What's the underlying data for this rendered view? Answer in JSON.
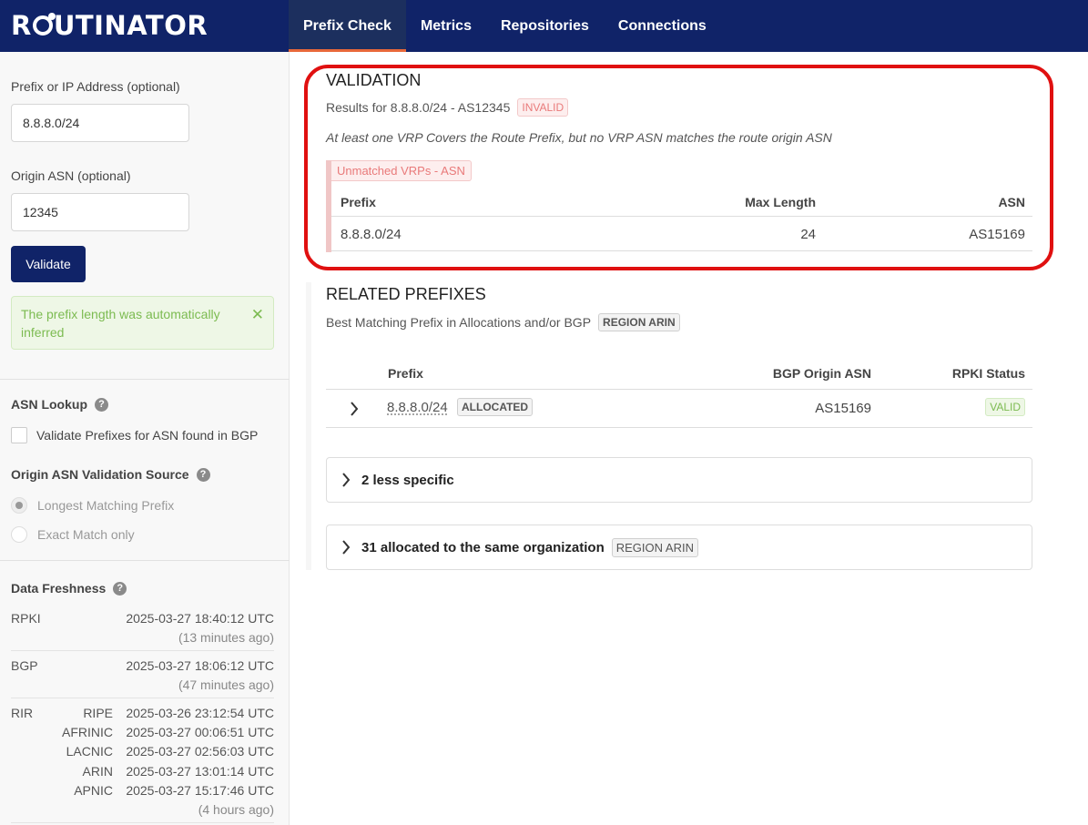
{
  "app": {
    "logo": "ROUTINATOR",
    "logo_parts": [
      "R",
      "UTINATOR"
    ]
  },
  "nav": {
    "tabs": [
      {
        "label": "Prefix Check",
        "active": true
      },
      {
        "label": "Metrics"
      },
      {
        "label": "Repositories"
      },
      {
        "label": "Connections"
      }
    ]
  },
  "form": {
    "prefix_label": "Prefix or IP Address (optional)",
    "prefix_value": "8.8.8.0/24",
    "asn_label": "Origin ASN (optional)",
    "asn_value": "12345",
    "validate_label": "Validate",
    "alert_text": "The prefix length was automatically inferred",
    "alert_close": "✕"
  },
  "asn_lookup": {
    "title": "ASN Lookup",
    "checkbox_label": "Validate Prefixes for ASN found in BGP",
    "checked": false
  },
  "origin_source": {
    "title": "Origin ASN Validation Source",
    "options": [
      {
        "label": "Longest Matching Prefix",
        "selected": true
      },
      {
        "label": "Exact Match only",
        "selected": false
      }
    ]
  },
  "freshness": {
    "title": "Data Freshness",
    "rpki": {
      "name": "RPKI",
      "time": "2025-03-27 18:40:12 UTC",
      "ago": "(13 minutes ago)"
    },
    "bgp": {
      "name": "BGP",
      "time": "2025-03-27 18:06:12 UTC",
      "ago": "(47 minutes ago)"
    },
    "rir": {
      "name": "RIR",
      "sources": [
        {
          "name": "RIPE",
          "time": "2025-03-26 23:12:54 UTC"
        },
        {
          "name": "AFRINIC",
          "time": "2025-03-27 00:06:51 UTC"
        },
        {
          "name": "LACNIC",
          "time": "2025-03-27 02:56:03 UTC"
        },
        {
          "name": "ARIN",
          "time": "2025-03-27 13:01:14 UTC"
        },
        {
          "name": "APNIC",
          "time": "2025-03-27 15:17:46 UTC"
        }
      ],
      "ago": "(4 hours ago)"
    },
    "help": "?"
  },
  "validation": {
    "title": "VALIDATION",
    "results_text": "Results for 8.8.8.0/24 - AS12345",
    "status": "INVALID",
    "note": "At least one VRP Covers the Route Prefix, but no VRP ASN matches the route origin ASN",
    "unmatched_tag": "Unmatched VRPs - ASN",
    "columns": {
      "prefix": "Prefix",
      "max_length": "Max Length",
      "asn": "ASN"
    },
    "rows": [
      {
        "prefix": "8.8.8.0/24",
        "max_length": "24",
        "asn": "AS15169"
      }
    ]
  },
  "related": {
    "title": "RELATED PREFIXES",
    "subtitle": "Best Matching Prefix in Allocations and/or BGP",
    "region_badge": "REGION ARIN",
    "columns": {
      "prefix": "Prefix",
      "bgp_origin": "BGP Origin ASN",
      "rpki_status": "RPKI Status"
    },
    "rows": [
      {
        "prefix": "8.8.8.0/24",
        "tag": "ALLOCATED",
        "bgp_origin": "AS15169",
        "rpki_status": "VALID"
      }
    ],
    "less_specific": "2 less specific",
    "same_org": "31 allocated to the same organization",
    "same_org_badge": "REGION ARIN"
  },
  "colors": {
    "nav_bg": "#102368",
    "accent": "#e8683a",
    "invalid": "#e97a7a",
    "valid": "#7cbb51",
    "highlight": "#e01010"
  }
}
